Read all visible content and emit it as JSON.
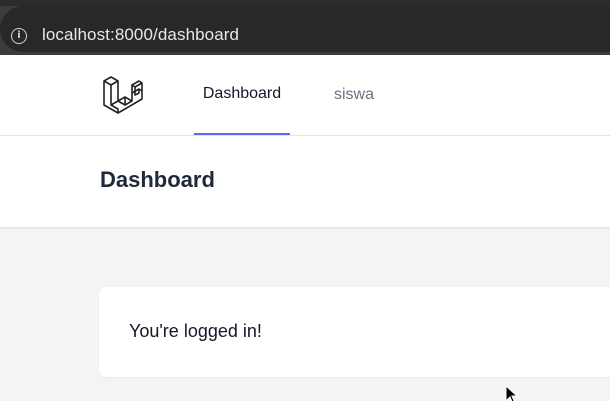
{
  "browser": {
    "url": "localhost:8000/dashboard"
  },
  "nav": {
    "logo": "laravel-logo",
    "links": [
      {
        "label": "Dashboard",
        "active": true
      },
      {
        "label": "siswa",
        "active": false
      }
    ]
  },
  "header": {
    "title": "Dashboard"
  },
  "main": {
    "message": "You're logged in!"
  },
  "colors": {
    "accent": "#6366f1",
    "page_bg": "#f3f4f6",
    "browser_bar": "#3c3c3c"
  }
}
